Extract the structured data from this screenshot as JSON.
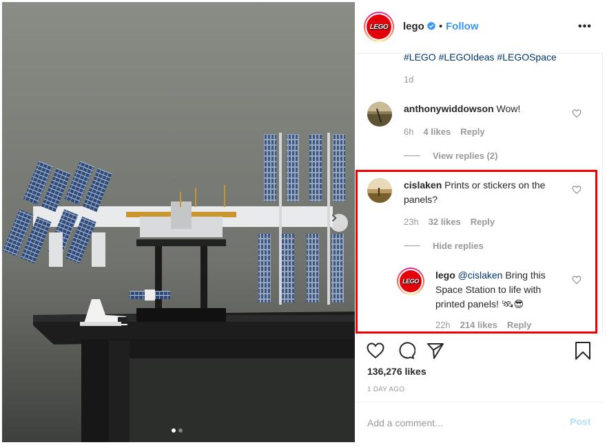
{
  "post": {
    "image_alt": "LEGO International Space Station set on a black table",
    "carousel": {
      "total_slides": 2,
      "active_slide": 1
    }
  },
  "header": {
    "username": "lego",
    "verified": true,
    "separator": "•",
    "follow_label": "Follow",
    "more_label": "•••",
    "avatar_text": "LEGO"
  },
  "caption": {
    "hashtags": "#LEGO #LEGOIdeas #LEGOSpace",
    "time": "1d"
  },
  "comments": [
    {
      "username": "anthonywiddowson",
      "text": "Wow!",
      "time": "6h",
      "likes": "4 likes",
      "reply_label": "Reply",
      "replies_toggle": "View replies (2)"
    },
    {
      "username": "cislaken",
      "text": "Prints or stickers on the panels?",
      "time": "23h",
      "likes": "32 likes",
      "reply_label": "Reply",
      "replies_toggle": "Hide replies",
      "replies": [
        {
          "username": "lego",
          "mention": "@cislaken",
          "text": "Bring this Space Station to life with printed panels! 🛰😎",
          "time": "22h",
          "likes": "214 likes",
          "reply_label": "Reply",
          "avatar_text": "LEGO"
        }
      ]
    }
  ],
  "actions": {
    "like": "heart-icon",
    "comment": "comment-icon",
    "share": "share-icon",
    "save": "bookmark-icon"
  },
  "likes_total": "136,276 likes",
  "posted": "1 DAY AGO",
  "add_comment": {
    "placeholder": "Add a comment...",
    "post_label": "Post"
  },
  "colors": {
    "link": "#3897f0",
    "hashtag": "#003569",
    "highlight": "#f00000",
    "muted": "#999999"
  }
}
